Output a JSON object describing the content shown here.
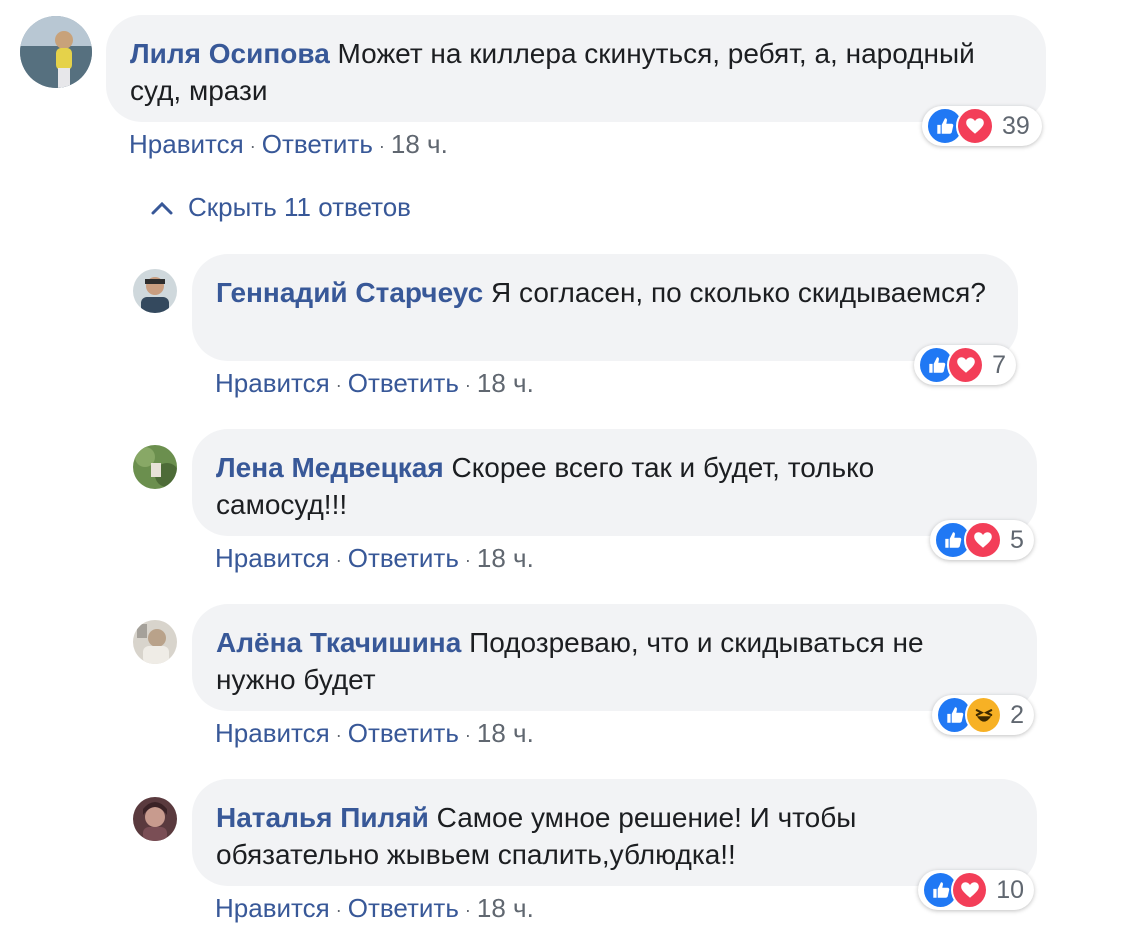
{
  "actions": {
    "like": "Нравится",
    "reply": "Ответить",
    "separator": "·"
  },
  "replies_toggle": "Скрыть 11 ответов",
  "comments": [
    {
      "author": "Лиля Осипова",
      "text": "Может на киллера скинуться, ребят, а, народный суд, мрази",
      "time": "18 ч.",
      "reaction_count": "39",
      "reactions": [
        "like-icon",
        "love-icon"
      ]
    },
    {
      "author": "Геннадий Старчеус",
      "text": "Я согласен, по сколько скидываемся?",
      "time": "18 ч.",
      "reaction_count": "7",
      "reactions": [
        "like-icon",
        "love-icon"
      ]
    },
    {
      "author": "Лена Медвецкая",
      "text": "Скорее всего так и будет, только самосуд!!!",
      "time": "18 ч.",
      "reaction_count": "5",
      "reactions": [
        "like-icon",
        "love-icon"
      ]
    },
    {
      "author": "Алёна Ткачишина",
      "text": "Подозреваю, что и скидываться не нужно будет",
      "time": "18 ч.",
      "reaction_count": "2",
      "reactions": [
        "like-icon",
        "haha-icon"
      ]
    },
    {
      "author": "Наталья Пиляй",
      "text": "Самое умное решение! И чтобы обязательно жывьем спалить,ублюдка!!",
      "time": "18 ч.",
      "reaction_count": "10",
      "reactions": [
        "like-icon",
        "love-icon"
      ]
    }
  ]
}
